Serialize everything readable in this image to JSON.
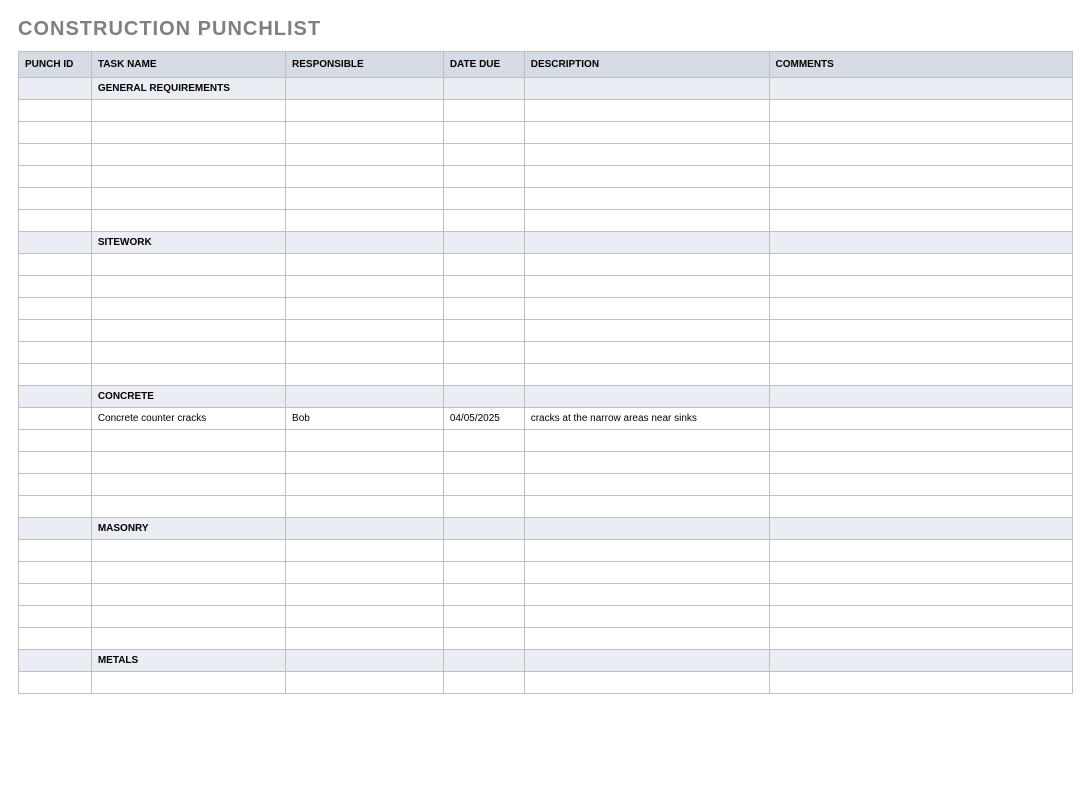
{
  "title": "CONSTRUCTION PUNCHLIST",
  "headers": {
    "punch_id": "PUNCH ID",
    "task_name": "TASK NAME",
    "responsible": "RESPONSIBLE",
    "date_due": "DATE DUE",
    "description": "DESCRIPTION",
    "comments": "COMMENTS"
  },
  "sections": [
    {
      "name": "GENERAL REQUIREMENTS",
      "rows": [
        {
          "punch_id": "",
          "task_name": "",
          "responsible": "",
          "date_due": "",
          "description": "",
          "comments": ""
        },
        {
          "punch_id": "",
          "task_name": "",
          "responsible": "",
          "date_due": "",
          "description": "",
          "comments": ""
        },
        {
          "punch_id": "",
          "task_name": "",
          "responsible": "",
          "date_due": "",
          "description": "",
          "comments": ""
        },
        {
          "punch_id": "",
          "task_name": "",
          "responsible": "",
          "date_due": "",
          "description": "",
          "comments": ""
        },
        {
          "punch_id": "",
          "task_name": "",
          "responsible": "",
          "date_due": "",
          "description": "",
          "comments": ""
        },
        {
          "punch_id": "",
          "task_name": "",
          "responsible": "",
          "date_due": "",
          "description": "",
          "comments": ""
        }
      ]
    },
    {
      "name": "SITEWORK",
      "rows": [
        {
          "punch_id": "",
          "task_name": "",
          "responsible": "",
          "date_due": "",
          "description": "",
          "comments": ""
        },
        {
          "punch_id": "",
          "task_name": "",
          "responsible": "",
          "date_due": "",
          "description": "",
          "comments": ""
        },
        {
          "punch_id": "",
          "task_name": "",
          "responsible": "",
          "date_due": "",
          "description": "",
          "comments": ""
        },
        {
          "punch_id": "",
          "task_name": "",
          "responsible": "",
          "date_due": "",
          "description": "",
          "comments": ""
        },
        {
          "punch_id": "",
          "task_name": "",
          "responsible": "",
          "date_due": "",
          "description": "",
          "comments": ""
        },
        {
          "punch_id": "",
          "task_name": "",
          "responsible": "",
          "date_due": "",
          "description": "",
          "comments": ""
        }
      ]
    },
    {
      "name": "CONCRETE",
      "rows": [
        {
          "punch_id": "",
          "task_name": "Concrete counter cracks",
          "responsible": "Bob",
          "date_due": "04/05/2025",
          "description": "cracks at the narrow areas near sinks",
          "comments": ""
        },
        {
          "punch_id": "",
          "task_name": "",
          "responsible": "",
          "date_due": "",
          "description": "",
          "comments": ""
        },
        {
          "punch_id": "",
          "task_name": "",
          "responsible": "",
          "date_due": "",
          "description": "",
          "comments": ""
        },
        {
          "punch_id": "",
          "task_name": "",
          "responsible": "",
          "date_due": "",
          "description": "",
          "comments": ""
        },
        {
          "punch_id": "",
          "task_name": "",
          "responsible": "",
          "date_due": "",
          "description": "",
          "comments": ""
        }
      ]
    },
    {
      "name": "MASONRY",
      "rows": [
        {
          "punch_id": "",
          "task_name": "",
          "responsible": "",
          "date_due": "",
          "description": "",
          "comments": ""
        },
        {
          "punch_id": "",
          "task_name": "",
          "responsible": "",
          "date_due": "",
          "description": "",
          "comments": ""
        },
        {
          "punch_id": "",
          "task_name": "",
          "responsible": "",
          "date_due": "",
          "description": "",
          "comments": ""
        },
        {
          "punch_id": "",
          "task_name": "",
          "responsible": "",
          "date_due": "",
          "description": "",
          "comments": ""
        },
        {
          "punch_id": "",
          "task_name": "",
          "responsible": "",
          "date_due": "",
          "description": "",
          "comments": ""
        }
      ]
    },
    {
      "name": "METALS",
      "rows": [
        {
          "punch_id": "",
          "task_name": "",
          "responsible": "",
          "date_due": "",
          "description": "",
          "comments": ""
        }
      ]
    }
  ]
}
